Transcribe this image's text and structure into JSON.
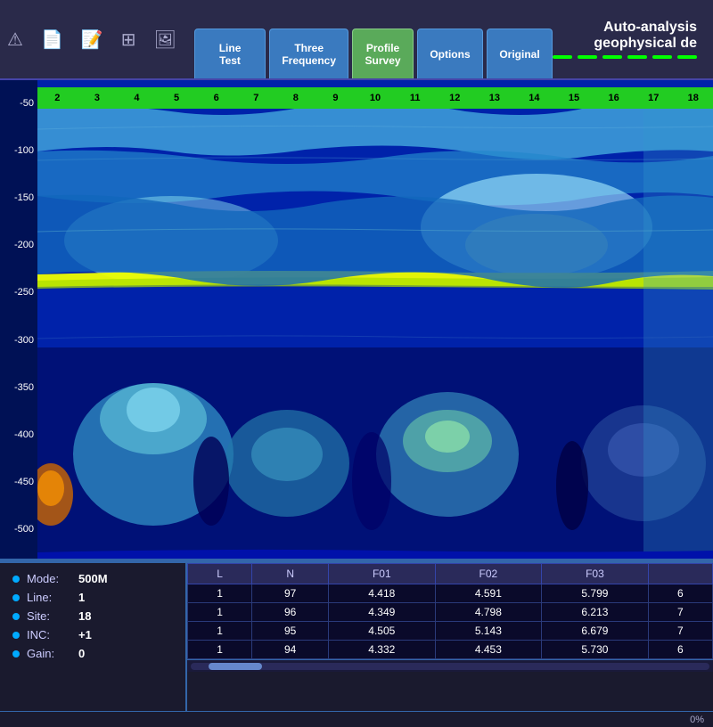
{
  "app": {
    "title": "Auto-analysis geophysical de"
  },
  "toolbar": {
    "icons": [
      {
        "name": "warning-icon",
        "symbol": "⚠"
      },
      {
        "name": "file-icon",
        "symbol": "📄"
      },
      {
        "name": "file-add-icon",
        "symbol": "📝"
      },
      {
        "name": "grid-icon",
        "symbol": "⊞"
      },
      {
        "name": "image-icon",
        "symbol": "🖼"
      }
    ]
  },
  "nav": {
    "tabs": [
      {
        "id": "line-test",
        "label": "Line Test",
        "active": false
      },
      {
        "id": "three-frequency",
        "label": "Three\nFrequency",
        "active": false
      },
      {
        "id": "profile-survey",
        "label": "Profile\nSurvey",
        "active": true
      },
      {
        "id": "options",
        "label": "Options",
        "active": false
      },
      {
        "id": "original",
        "label": "Original",
        "active": false
      }
    ]
  },
  "legend": {
    "dots": [
      1,
      2,
      3,
      4,
      5,
      6
    ]
  },
  "visualization": {
    "x_labels": [
      "2",
      "3",
      "4",
      "5",
      "6",
      "7",
      "8",
      "9",
      "10",
      "11",
      "12",
      "13",
      "14",
      "15",
      "16",
      "17",
      "18"
    ],
    "y_labels": [
      "-50",
      "-100",
      "-150",
      "-200",
      "-250",
      "-300",
      "-350",
      "-400",
      "-450",
      "-500"
    ]
  },
  "info_panel": {
    "rows": [
      {
        "label": "Mode:",
        "value": "500M"
      },
      {
        "label": "Line:",
        "value": "1"
      },
      {
        "label": "Site:",
        "value": "18"
      },
      {
        "label": "INC:",
        "value": "+1"
      },
      {
        "label": "Gain:",
        "value": "0"
      }
    ]
  },
  "table": {
    "headers": [
      "L",
      "N",
      "F01",
      "F02",
      "F03",
      ""
    ],
    "rows": [
      [
        "1",
        "97",
        "4.418",
        "4.591",
        "5.799",
        "6"
      ],
      [
        "1",
        "96",
        "4.349",
        "4.798",
        "6.213",
        "7"
      ],
      [
        "1",
        "95",
        "4.505",
        "5.143",
        "6.679",
        "7"
      ],
      [
        "1",
        "94",
        "4.332",
        "4.453",
        "5.730",
        "6"
      ]
    ]
  },
  "status": {
    "text": "0%"
  }
}
